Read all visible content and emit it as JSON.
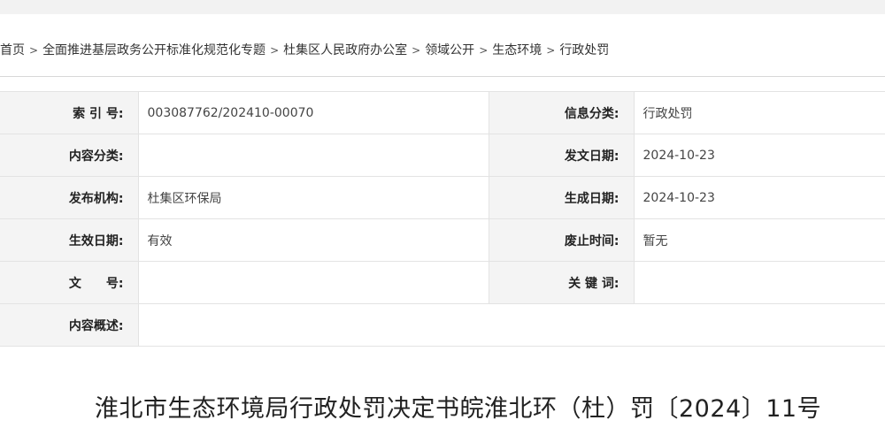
{
  "breadcrumb": [
    "首页",
    "全面推进基层政务公开标准化规范化专题",
    "杜集区人民政府办公室",
    "领域公开",
    "生态环境",
    "行政处罚"
  ],
  "breadcrumb_sep": ">",
  "info": {
    "index_label": "索 引 号:",
    "index_value": "003087762/202410-00070",
    "category_label": "信息分类:",
    "category_value": "行政处罚",
    "content_cat_label": "内容分类:",
    "content_cat_value": "",
    "issue_date_label": "发文日期:",
    "issue_date_value": "2024-10-23",
    "publisher_label": "发布机构:",
    "publisher_value": "杜集区环保局",
    "created_date_label": "生成日期:",
    "created_date_value": "2024-10-23",
    "effective_label": "生效日期:",
    "effective_value": "有效",
    "abolish_label": "废止时间:",
    "abolish_value": "暂无",
    "doc_no_label": "文　　号:",
    "doc_no_value": "",
    "keywords_label": "关 键 词:",
    "keywords_value": "",
    "summary_label": "内容概述:",
    "summary_value": ""
  },
  "document_title": "淮北市生态环境局行政处罚决定书皖淮北环（杜）罚〔2024〕11号"
}
